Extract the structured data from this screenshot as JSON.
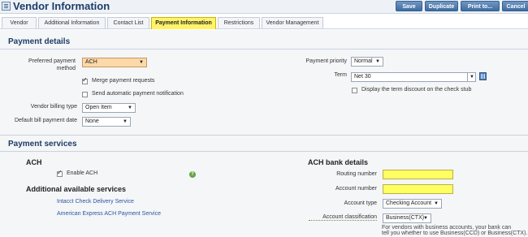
{
  "header": {
    "title": "Vendor Information",
    "buttons": {
      "save": "Save",
      "duplicate": "Duplicate",
      "print": "Print to...",
      "cancel": "Cancel"
    }
  },
  "tabs": [
    "Vendor",
    "Additional Information",
    "Contact List",
    "Payment Information",
    "Restrictions",
    "Vendor Management"
  ],
  "active_tab": "Payment Information",
  "payment_details": {
    "heading": "Payment details",
    "preferred_method_label_1": "Preferred payment",
    "preferred_method_label_2": "method",
    "preferred_method_value": "ACH",
    "merge_label": "Merge payment requests",
    "merge_checked": true,
    "send_notification_label": "Send automatic payment notification",
    "send_notification_checked": false,
    "billing_type_label": "Vendor billing type",
    "billing_type_value": "Open Item",
    "default_bill_date_label": "Default bill payment date",
    "default_bill_date_value": "None",
    "priority_label": "Payment priority",
    "priority_value": "Normal",
    "term_label": "Term",
    "term_value": "Net 30",
    "term_discount_label": "Display the term discount on the check stub",
    "term_discount_checked": false
  },
  "payment_services": {
    "heading": "Payment services",
    "ach_heading": "ACH",
    "enable_ach_label": "Enable ACH",
    "enable_ach_checked": true,
    "help_icon": "?",
    "additional_heading": "Additional available services",
    "service_links": [
      "Intacct Check Delivery Service",
      "American Express ACH Payment Service"
    ],
    "bank_heading": "ACH bank details",
    "routing_label": "Routing number",
    "routing_value": "",
    "account_number_label": "Account number",
    "account_number_value": "",
    "account_type_label": "Account type",
    "account_type_value": "Checking Account",
    "classification_label": "Account classification",
    "classification_value": "Business(CTX)",
    "note_line_1": "For vendors with business accounts, your bank can",
    "note_line_2": "tell you whether to use Business(CCD) or Business(CTX)."
  },
  "colors": {
    "title": "#1d3b66",
    "active_tab": "#fff36a",
    "required_field": "#ffff62",
    "preferred_select": "#fdd8a8",
    "button": "#4f7db2",
    "link": "#2a55a3"
  }
}
